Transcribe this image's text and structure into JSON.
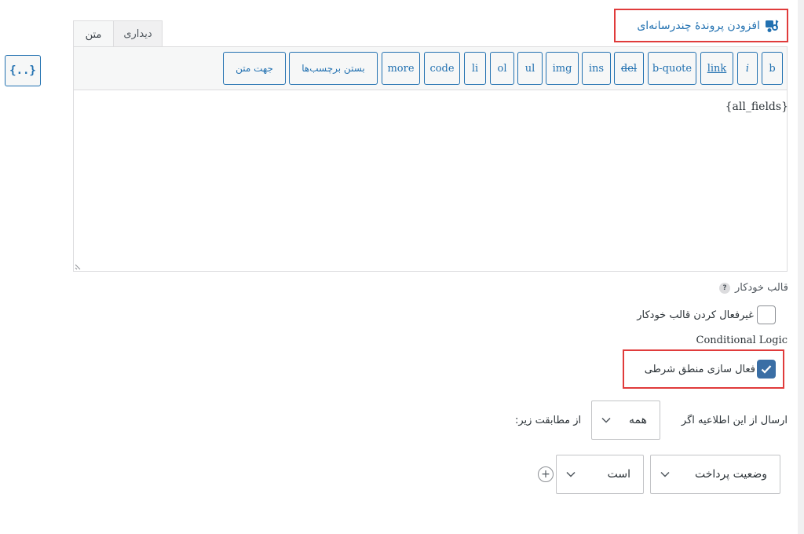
{
  "merge_tags": {
    "icon_text": "{..}"
  },
  "add_media": {
    "label": "افزودن پروندهٔ چندرسانه‌ای"
  },
  "tabs": {
    "visual": "دیداری",
    "text": "متن"
  },
  "toolbar": {
    "buttons": [
      {
        "key": "b",
        "label": "b"
      },
      {
        "key": "i",
        "label": "i"
      },
      {
        "key": "link",
        "label": "link"
      },
      {
        "key": "bquote",
        "label": "b-quote"
      },
      {
        "key": "del",
        "label": "del"
      },
      {
        "key": "ins",
        "label": "ins"
      },
      {
        "key": "img",
        "label": "img"
      },
      {
        "key": "ul",
        "label": "ul"
      },
      {
        "key": "ol",
        "label": "ol"
      },
      {
        "key": "li",
        "label": "li"
      },
      {
        "key": "code",
        "label": "code"
      },
      {
        "key": "more",
        "label": "more"
      },
      {
        "key": "close",
        "label": "بستن برچسب‌ها"
      },
      {
        "key": "direction",
        "label": "جهت متن"
      }
    ]
  },
  "editor": {
    "content": "{all_fields}"
  },
  "autoformat": {
    "label": "قالب خودکار",
    "help": "?",
    "disable_label": "غیرفعال کردن قالب خودکار",
    "disable_checked": false
  },
  "conditional": {
    "heading": "Conditional Logic",
    "enable_label": "فعال سازی منطق شرطی",
    "enable_checked": true,
    "send_if": "ارسال از این اطلاعیه اگر",
    "match_value": "همه",
    "match_suffix": "از مطابقت زیر:",
    "rule_field": "وضعیت پرداخت",
    "rule_operator": "است",
    "add_rule": "+"
  },
  "colors": {
    "accent": "#2271b1",
    "highlight": "#e03b3b",
    "checked": "#3a6ea5"
  }
}
